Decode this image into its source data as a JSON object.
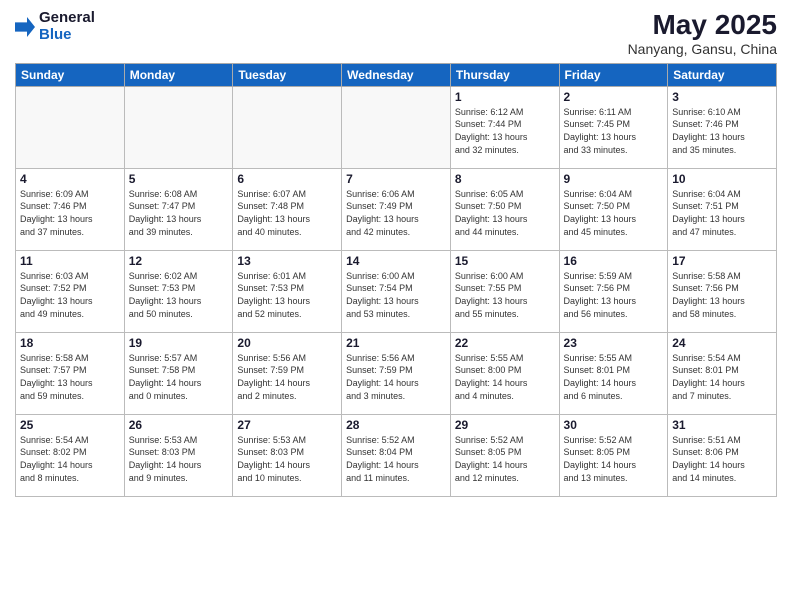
{
  "logo": {
    "general": "General",
    "blue": "Blue"
  },
  "title": {
    "month_year": "May 2025",
    "location": "Nanyang, Gansu, China"
  },
  "headers": [
    "Sunday",
    "Monday",
    "Tuesday",
    "Wednesday",
    "Thursday",
    "Friday",
    "Saturday"
  ],
  "weeks": [
    [
      {
        "day": "",
        "info": ""
      },
      {
        "day": "",
        "info": ""
      },
      {
        "day": "",
        "info": ""
      },
      {
        "day": "",
        "info": ""
      },
      {
        "day": "1",
        "info": "Sunrise: 6:12 AM\nSunset: 7:44 PM\nDaylight: 13 hours\nand 32 minutes."
      },
      {
        "day": "2",
        "info": "Sunrise: 6:11 AM\nSunset: 7:45 PM\nDaylight: 13 hours\nand 33 minutes."
      },
      {
        "day": "3",
        "info": "Sunrise: 6:10 AM\nSunset: 7:46 PM\nDaylight: 13 hours\nand 35 minutes."
      }
    ],
    [
      {
        "day": "4",
        "info": "Sunrise: 6:09 AM\nSunset: 7:46 PM\nDaylight: 13 hours\nand 37 minutes."
      },
      {
        "day": "5",
        "info": "Sunrise: 6:08 AM\nSunset: 7:47 PM\nDaylight: 13 hours\nand 39 minutes."
      },
      {
        "day": "6",
        "info": "Sunrise: 6:07 AM\nSunset: 7:48 PM\nDaylight: 13 hours\nand 40 minutes."
      },
      {
        "day": "7",
        "info": "Sunrise: 6:06 AM\nSunset: 7:49 PM\nDaylight: 13 hours\nand 42 minutes."
      },
      {
        "day": "8",
        "info": "Sunrise: 6:05 AM\nSunset: 7:50 PM\nDaylight: 13 hours\nand 44 minutes."
      },
      {
        "day": "9",
        "info": "Sunrise: 6:04 AM\nSunset: 7:50 PM\nDaylight: 13 hours\nand 45 minutes."
      },
      {
        "day": "10",
        "info": "Sunrise: 6:04 AM\nSunset: 7:51 PM\nDaylight: 13 hours\nand 47 minutes."
      }
    ],
    [
      {
        "day": "11",
        "info": "Sunrise: 6:03 AM\nSunset: 7:52 PM\nDaylight: 13 hours\nand 49 minutes."
      },
      {
        "day": "12",
        "info": "Sunrise: 6:02 AM\nSunset: 7:53 PM\nDaylight: 13 hours\nand 50 minutes."
      },
      {
        "day": "13",
        "info": "Sunrise: 6:01 AM\nSunset: 7:53 PM\nDaylight: 13 hours\nand 52 minutes."
      },
      {
        "day": "14",
        "info": "Sunrise: 6:00 AM\nSunset: 7:54 PM\nDaylight: 13 hours\nand 53 minutes."
      },
      {
        "day": "15",
        "info": "Sunrise: 6:00 AM\nSunset: 7:55 PM\nDaylight: 13 hours\nand 55 minutes."
      },
      {
        "day": "16",
        "info": "Sunrise: 5:59 AM\nSunset: 7:56 PM\nDaylight: 13 hours\nand 56 minutes."
      },
      {
        "day": "17",
        "info": "Sunrise: 5:58 AM\nSunset: 7:56 PM\nDaylight: 13 hours\nand 58 minutes."
      }
    ],
    [
      {
        "day": "18",
        "info": "Sunrise: 5:58 AM\nSunset: 7:57 PM\nDaylight: 13 hours\nand 59 minutes."
      },
      {
        "day": "19",
        "info": "Sunrise: 5:57 AM\nSunset: 7:58 PM\nDaylight: 14 hours\nand 0 minutes."
      },
      {
        "day": "20",
        "info": "Sunrise: 5:56 AM\nSunset: 7:59 PM\nDaylight: 14 hours\nand 2 minutes."
      },
      {
        "day": "21",
        "info": "Sunrise: 5:56 AM\nSunset: 7:59 PM\nDaylight: 14 hours\nand 3 minutes."
      },
      {
        "day": "22",
        "info": "Sunrise: 5:55 AM\nSunset: 8:00 PM\nDaylight: 14 hours\nand 4 minutes."
      },
      {
        "day": "23",
        "info": "Sunrise: 5:55 AM\nSunset: 8:01 PM\nDaylight: 14 hours\nand 6 minutes."
      },
      {
        "day": "24",
        "info": "Sunrise: 5:54 AM\nSunset: 8:01 PM\nDaylight: 14 hours\nand 7 minutes."
      }
    ],
    [
      {
        "day": "25",
        "info": "Sunrise: 5:54 AM\nSunset: 8:02 PM\nDaylight: 14 hours\nand 8 minutes."
      },
      {
        "day": "26",
        "info": "Sunrise: 5:53 AM\nSunset: 8:03 PM\nDaylight: 14 hours\nand 9 minutes."
      },
      {
        "day": "27",
        "info": "Sunrise: 5:53 AM\nSunset: 8:03 PM\nDaylight: 14 hours\nand 10 minutes."
      },
      {
        "day": "28",
        "info": "Sunrise: 5:52 AM\nSunset: 8:04 PM\nDaylight: 14 hours\nand 11 minutes."
      },
      {
        "day": "29",
        "info": "Sunrise: 5:52 AM\nSunset: 8:05 PM\nDaylight: 14 hours\nand 12 minutes."
      },
      {
        "day": "30",
        "info": "Sunrise: 5:52 AM\nSunset: 8:05 PM\nDaylight: 14 hours\nand 13 minutes."
      },
      {
        "day": "31",
        "info": "Sunrise: 5:51 AM\nSunset: 8:06 PM\nDaylight: 14 hours\nand 14 minutes."
      }
    ]
  ]
}
